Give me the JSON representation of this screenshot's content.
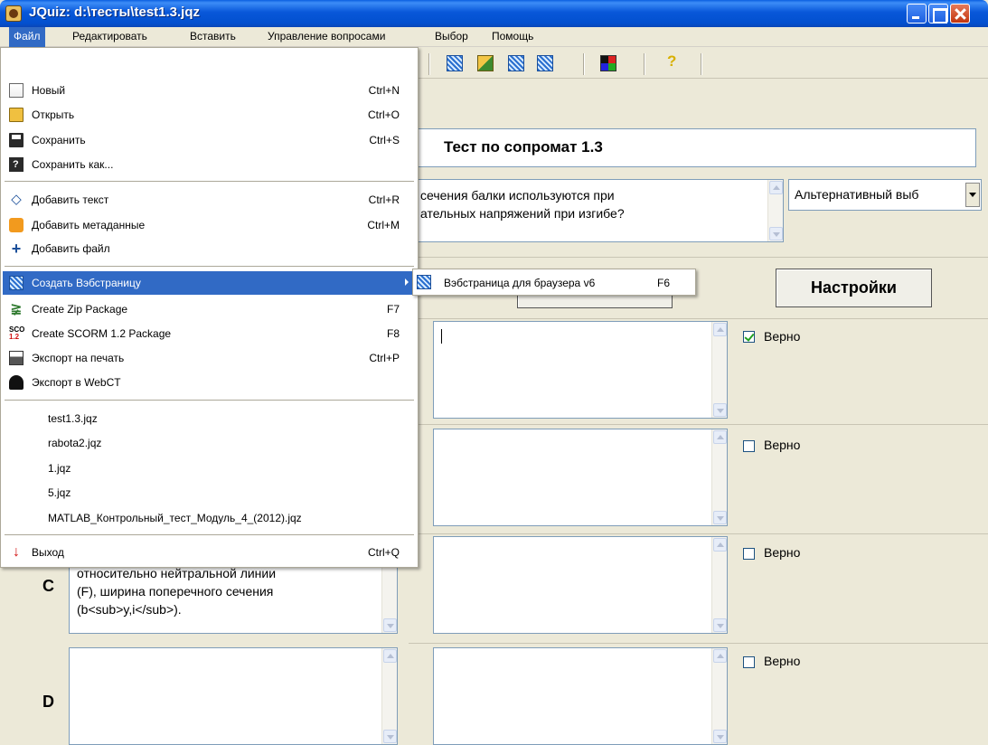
{
  "window": {
    "title": "JQuiz: d:\\тесты\\test1.3.jqz"
  },
  "menubar": {
    "items": [
      "Файл",
      "Редактировать",
      "Вставить",
      "Управление вопросами",
      "Выбор",
      "Помощь"
    ]
  },
  "quiz": {
    "title": "Тест по сопромат 1.3",
    "question_line1": "сечения балки используются при",
    "question_line2": "ательных напряжений при изгибе?",
    "question_type": "Альтернативный выб",
    "settings_button": "Настройки"
  },
  "answers": {
    "a": {
      "correct_label": "Верно",
      "checked": true
    },
    "b": {
      "correct_label": "Верно",
      "checked": false
    },
    "c": {
      "letter": "C",
      "text_line1": "относительно нейтральной линии",
      "text_line2": "(F), ширина поперечного сечения",
      "text_line3": "(b<sub>y,i</sub>).",
      "correct_label": "Верно",
      "checked": false
    },
    "d": {
      "letter": "D",
      "correct_label": "Верно",
      "checked": false
    }
  },
  "file_menu": {
    "new": {
      "label": "Новый",
      "shortcut": "Ctrl+N",
      "icon": "new-document-icon"
    },
    "open": {
      "label": "Открыть",
      "shortcut": "Ctrl+O",
      "icon": "open-folder-icon"
    },
    "save": {
      "label": "Сохранить",
      "shortcut": "Ctrl+S",
      "icon": "floppy-disk-icon"
    },
    "save_as": {
      "label": "Сохранить как...",
      "icon": "save-as-icon"
    },
    "add_text": {
      "label": "Добавить текст",
      "shortcut": "Ctrl+R",
      "icon": "add-text-icon"
    },
    "add_meta": {
      "label": "Добавить метаданные",
      "shortcut": "Ctrl+M",
      "icon": "metadata-icon"
    },
    "add_file": {
      "label": "Добавить файл",
      "icon": "plus-icon"
    },
    "create_web": {
      "label": "Создать Вэбстраницу",
      "icon": "web-page-icon"
    },
    "zip": {
      "label": "Create Zip Package",
      "shortcut": "F7",
      "icon": "zip-icon"
    },
    "scorm": {
      "label": "Create SCORM 1.2 Package",
      "shortcut": "F8",
      "icon_text": "SCO\n1.2"
    },
    "print": {
      "label": "Экспорт на печать",
      "shortcut": "Ctrl+P",
      "icon": "printer-icon"
    },
    "webct": {
      "label": "Экспорт в WebCT",
      "icon": "webct-icon"
    },
    "recent": [
      "test1.3.jqz",
      "rabota2.jqz",
      "1.jqz",
      "5.jqz",
      "MATLAB_Контрольный_тест_Модуль_4_(2012).jqz"
    ],
    "exit": {
      "label": "Выход",
      "shortcut": "Ctrl+Q",
      "icon": "exit-arrow-icon"
    }
  },
  "submenu": {
    "browser_v6": {
      "label": "Вэбстраница для браузера v6",
      "shortcut": "F6"
    }
  },
  "colors": {
    "highlight": "#316ac5",
    "titlebar": "#0857d9",
    "window_bg": "#ece9d8"
  }
}
